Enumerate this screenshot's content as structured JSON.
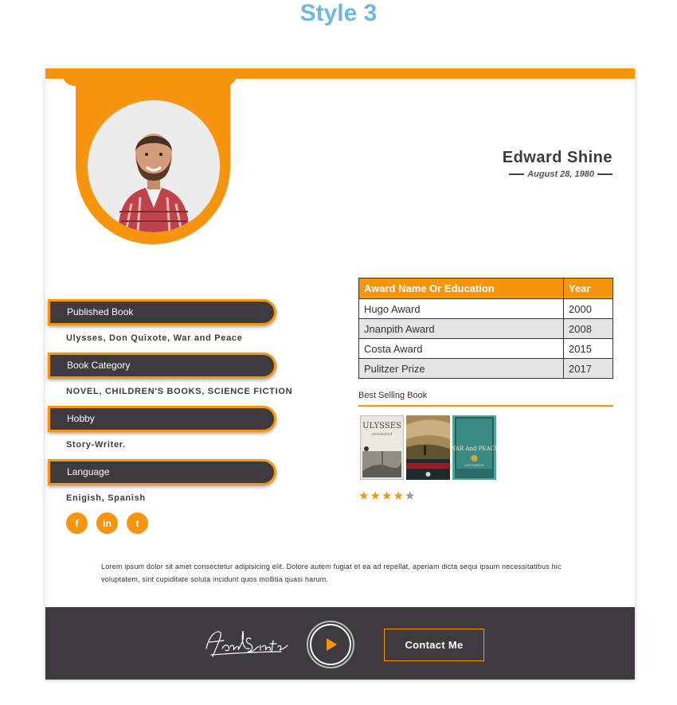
{
  "page": {
    "style_title": "Style 3"
  },
  "profile": {
    "name": "Edward Shine",
    "dob": "August 28, 1980"
  },
  "info": [
    {
      "label": "Published Book",
      "value": "Ulysses, Don Quixote, War and Peace"
    },
    {
      "label": "Book Category",
      "value": "NOVEL, CHILDREN'S BOOKS, SCIENCE FICTION"
    },
    {
      "label": "Hobby",
      "value": "Story-Writer."
    },
    {
      "label": "Language",
      "value": "Enigish, Spanish"
    }
  ],
  "social": [
    {
      "icon": "facebook-icon",
      "glyph": "f"
    },
    {
      "icon": "linkedin-icon",
      "glyph": "in"
    },
    {
      "icon": "twitter-icon",
      "glyph": "t"
    }
  ],
  "awards": {
    "headers": [
      "Award Name Or Education",
      "Year"
    ],
    "rows": [
      [
        "Hugo Award",
        "2000"
      ],
      [
        "Jnanpith Award",
        "2008"
      ],
      [
        "Costa Award",
        "2015"
      ],
      [
        "Pulitzer Prize",
        "2017"
      ]
    ]
  },
  "best_selling": {
    "title": "Best Selling Book",
    "books": [
      {
        "title": "ULYSSES",
        "subtitle": "annotated"
      },
      {
        "title": "",
        "subtitle": ""
      },
      {
        "title": "WAR And PEACE",
        "subtitle": "LEO TOLSTOY"
      }
    ],
    "rating": 4,
    "max_rating": 5
  },
  "bio": "Lorem ipsum dolor sit amet consectetur adipisicing elit. Dolore autem fugiat et ea ad repellat, aperiam dicta sequi ipsum necessitatibus hic voluptatem, sint cupiditate soluta incidunt quos mollitia quasi harum.",
  "footer": {
    "signature": "Frank Sinatra",
    "contact_label": "Contact Me"
  },
  "colors": {
    "accent": "#f8950f",
    "dark": "#3d3b3e",
    "title_blue": "#6bb8e4"
  }
}
